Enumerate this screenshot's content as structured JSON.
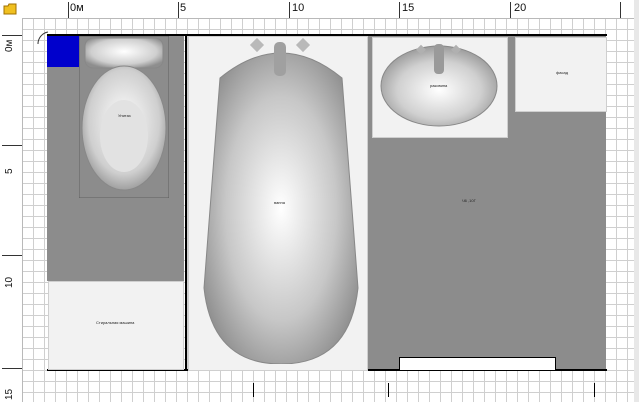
{
  "ruler": {
    "x_labels": [
      "0м",
      "5",
      "10",
      "15",
      "20"
    ],
    "y_labels": [
      "0м",
      "5",
      "10",
      "15"
    ]
  },
  "plan": {
    "toilet_label": "Унитаз",
    "bathtub_label": "ванна",
    "sink_label": "раковина",
    "room_label": "Ч6 ,10Г",
    "washer_label": "Стиральная машина",
    "cabinet_label": "фасад"
  },
  "colors": {
    "floor": "#8c8c8c",
    "wall": "#000000",
    "selection": "#0000cc"
  }
}
